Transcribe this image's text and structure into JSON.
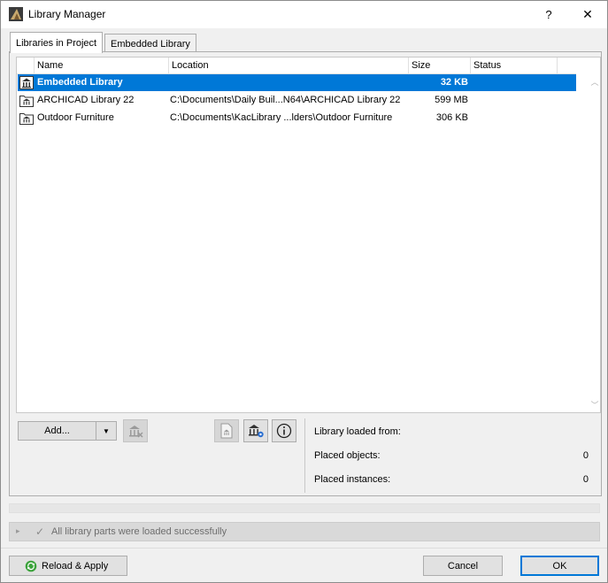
{
  "window": {
    "title": "Library Manager",
    "help_glyph": "?",
    "close_glyph": "✕"
  },
  "tabs": [
    {
      "label": "Libraries in Project",
      "active": true
    },
    {
      "label": "Embedded Library",
      "active": false
    }
  ],
  "list": {
    "columns": {
      "name": "Name",
      "location": "Location",
      "size": "Size",
      "status": "Status"
    },
    "rows": [
      {
        "name": "Embedded Library",
        "location": "",
        "size": "32 KB",
        "status": "",
        "selected": true,
        "icon": "embedded-library-icon"
      },
      {
        "name": "ARCHICAD Library 22",
        "location": "C:\\Documents\\Daily Buil...N64\\ARCHICAD Library 22",
        "size": "599 MB",
        "status": "",
        "selected": false,
        "icon": "library-folder-icon"
      },
      {
        "name": "Outdoor Furniture",
        "location": "C:\\Documents\\KacLibrary ...lders\\Outdoor Furniture",
        "size": "306 KB",
        "status": "",
        "selected": false,
        "icon": "library-folder-icon"
      }
    ]
  },
  "toolbar": {
    "add_label": "Add...",
    "dropdown_glyph": "▼"
  },
  "info": {
    "loaded_from_label": "Library loaded from:",
    "loaded_from_value": "",
    "placed_objects_label": "Placed objects:",
    "placed_objects_value": "0",
    "placed_instances_label": "Placed instances:",
    "placed_instances_value": "0"
  },
  "status": {
    "expand_glyph": "▸",
    "check_glyph": "✓",
    "message": "All library parts were loaded successfully"
  },
  "footer": {
    "reload_label": "Reload & Apply",
    "cancel_label": "Cancel",
    "ok_label": "OK"
  },
  "colors": {
    "selection": "#0078d7",
    "reload_icon": "#3aa23a"
  }
}
